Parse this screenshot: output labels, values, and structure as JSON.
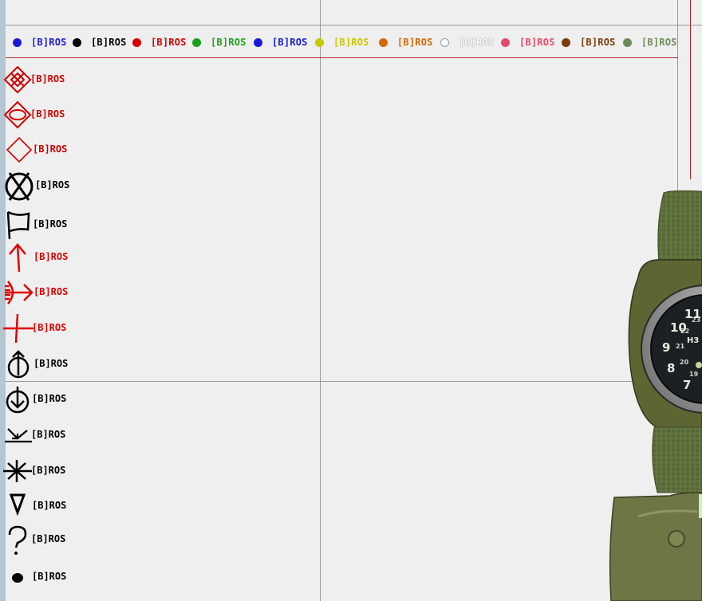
{
  "colors": {
    "background": "#efefef",
    "grid_line": "#9a9a9a",
    "map_red_line": "#c02222",
    "left_strip": "#b4c6d2"
  },
  "legend": {
    "items": [
      {
        "label": "[B]ROS",
        "color": "#1a1ad6",
        "color_name": "blue"
      },
      {
        "label": "[B]ROS",
        "color": "#000000",
        "color_name": "black"
      },
      {
        "label": "[B]ROS",
        "color": "#d40000",
        "color_name": "red"
      },
      {
        "label": "[B]ROS",
        "color": "#1aa11a",
        "color_name": "green"
      },
      {
        "label": "[B]ROS",
        "color": "#1a1ad6",
        "color_name": "blue"
      },
      {
        "label": "[B]ROS",
        "color": "#c8c800",
        "color_name": "yellow"
      },
      {
        "label": "[B]ROS",
        "color": "#d46a00",
        "color_name": "orange"
      },
      {
        "label": "[B]ROS",
        "color": "#ffffff",
        "color_name": "white"
      },
      {
        "label": "[B]ROS",
        "color": "#e04c6a",
        "color_name": "pink"
      },
      {
        "label": "[B]ROS",
        "color": "#7a3d0a",
        "color_name": "brown"
      },
      {
        "label": "[B]ROS",
        "color": "#6f8a5a",
        "color_name": "khaki"
      }
    ]
  },
  "markers": [
    {
      "icon": "objective-diamond-cross-icon",
      "label": "[B]ROS",
      "color": "#d40000"
    },
    {
      "icon": "objective-diamond-oval-icon",
      "label": "[B]ROS",
      "color": "#d40000"
    },
    {
      "icon": "diamond-icon",
      "label": "[B]ROS",
      "color": "#d40000"
    },
    {
      "icon": "destroy-circle-x-icon",
      "label": "[B]ROS",
      "color": "#000000"
    },
    {
      "icon": "flag-icon",
      "label": "[B]ROS",
      "color": "#000000"
    },
    {
      "icon": "arrow-up-icon",
      "label": "[B]ROS",
      "color": "#d40000"
    },
    {
      "icon": "ambush-arrow-icon",
      "label": "[B]ROS",
      "color": "#d40000"
    },
    {
      "icon": "cross-hair-icon",
      "label": "[B]ROS",
      "color": "#d40000"
    },
    {
      "icon": "pickup-icon",
      "label": "[B]ROS",
      "color": "#000000"
    },
    {
      "icon": "dropoff-icon",
      "label": "[B]ROS",
      "color": "#000000"
    },
    {
      "icon": "join-arrow-icon",
      "label": "[B]ROS",
      "color": "#000000"
    },
    {
      "icon": "starburst-icon",
      "label": "[B]ROS",
      "color": "#000000"
    },
    {
      "icon": "warning-triangle-icon",
      "label": "[B]ROS",
      "color": "#000000"
    },
    {
      "icon": "question-mark-icon",
      "label": "[B]ROS",
      "color": "#000000"
    },
    {
      "icon": "dot-icon",
      "label": "[B]ROS",
      "color": "#000000"
    }
  ],
  "watch": {
    "dial_numbers": [
      "11",
      "10",
      "9",
      "8",
      "7"
    ],
    "dial_small_numbers": [
      "23",
      "22",
      "21",
      "20",
      "19"
    ],
    "brand": "H3"
  }
}
